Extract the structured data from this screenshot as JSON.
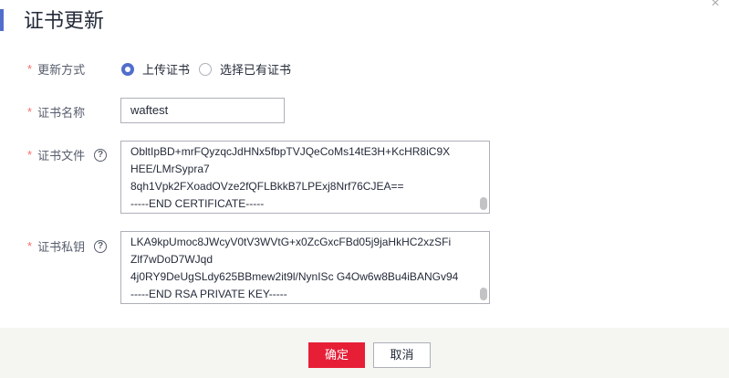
{
  "dialog": {
    "title": "证书更新",
    "close_icon": "close-icon"
  },
  "form": {
    "update_method": {
      "label": "更新方式",
      "options": [
        {
          "label": "上传证书",
          "selected": true
        },
        {
          "label": "选择已有证书",
          "selected": false
        }
      ]
    },
    "cert_name": {
      "label": "证书名称",
      "value": "waftest"
    },
    "cert_file": {
      "label": "证书文件",
      "lines": [
        "ObltIpBD+mrFQyzqcJdHNx5fbpTVJQeCoMs14tE3H+KcHR8iC9X",
        "HEE/LMrSypra7",
        "8qh1Vpk2FXoadOVze2fQFLBkkB7LPExj8Nrf76CJEA==",
        "-----END CERTIFICATE-----"
      ]
    },
    "private_key": {
      "label": "证书私钥",
      "lines": [
        "LKA9kpUmoc8JWcyV0tV3WVtG+x0ZcGxcFBd05j9jaHkHC2xzSFi",
        "Zlf7wDoD7WJqd",
        "4j0RY9DeUgSLdy625BBmew2it9l/NynISc G4Ow6w8Bu4iBANGv94",
        "-----END RSA PRIVATE KEY-----"
      ]
    }
  },
  "footer": {
    "ok_label": "确定",
    "cancel_label": "取消"
  },
  "colors": {
    "primary": "#526ecc",
    "danger": "#e61f37",
    "required": "#f66f6a"
  }
}
